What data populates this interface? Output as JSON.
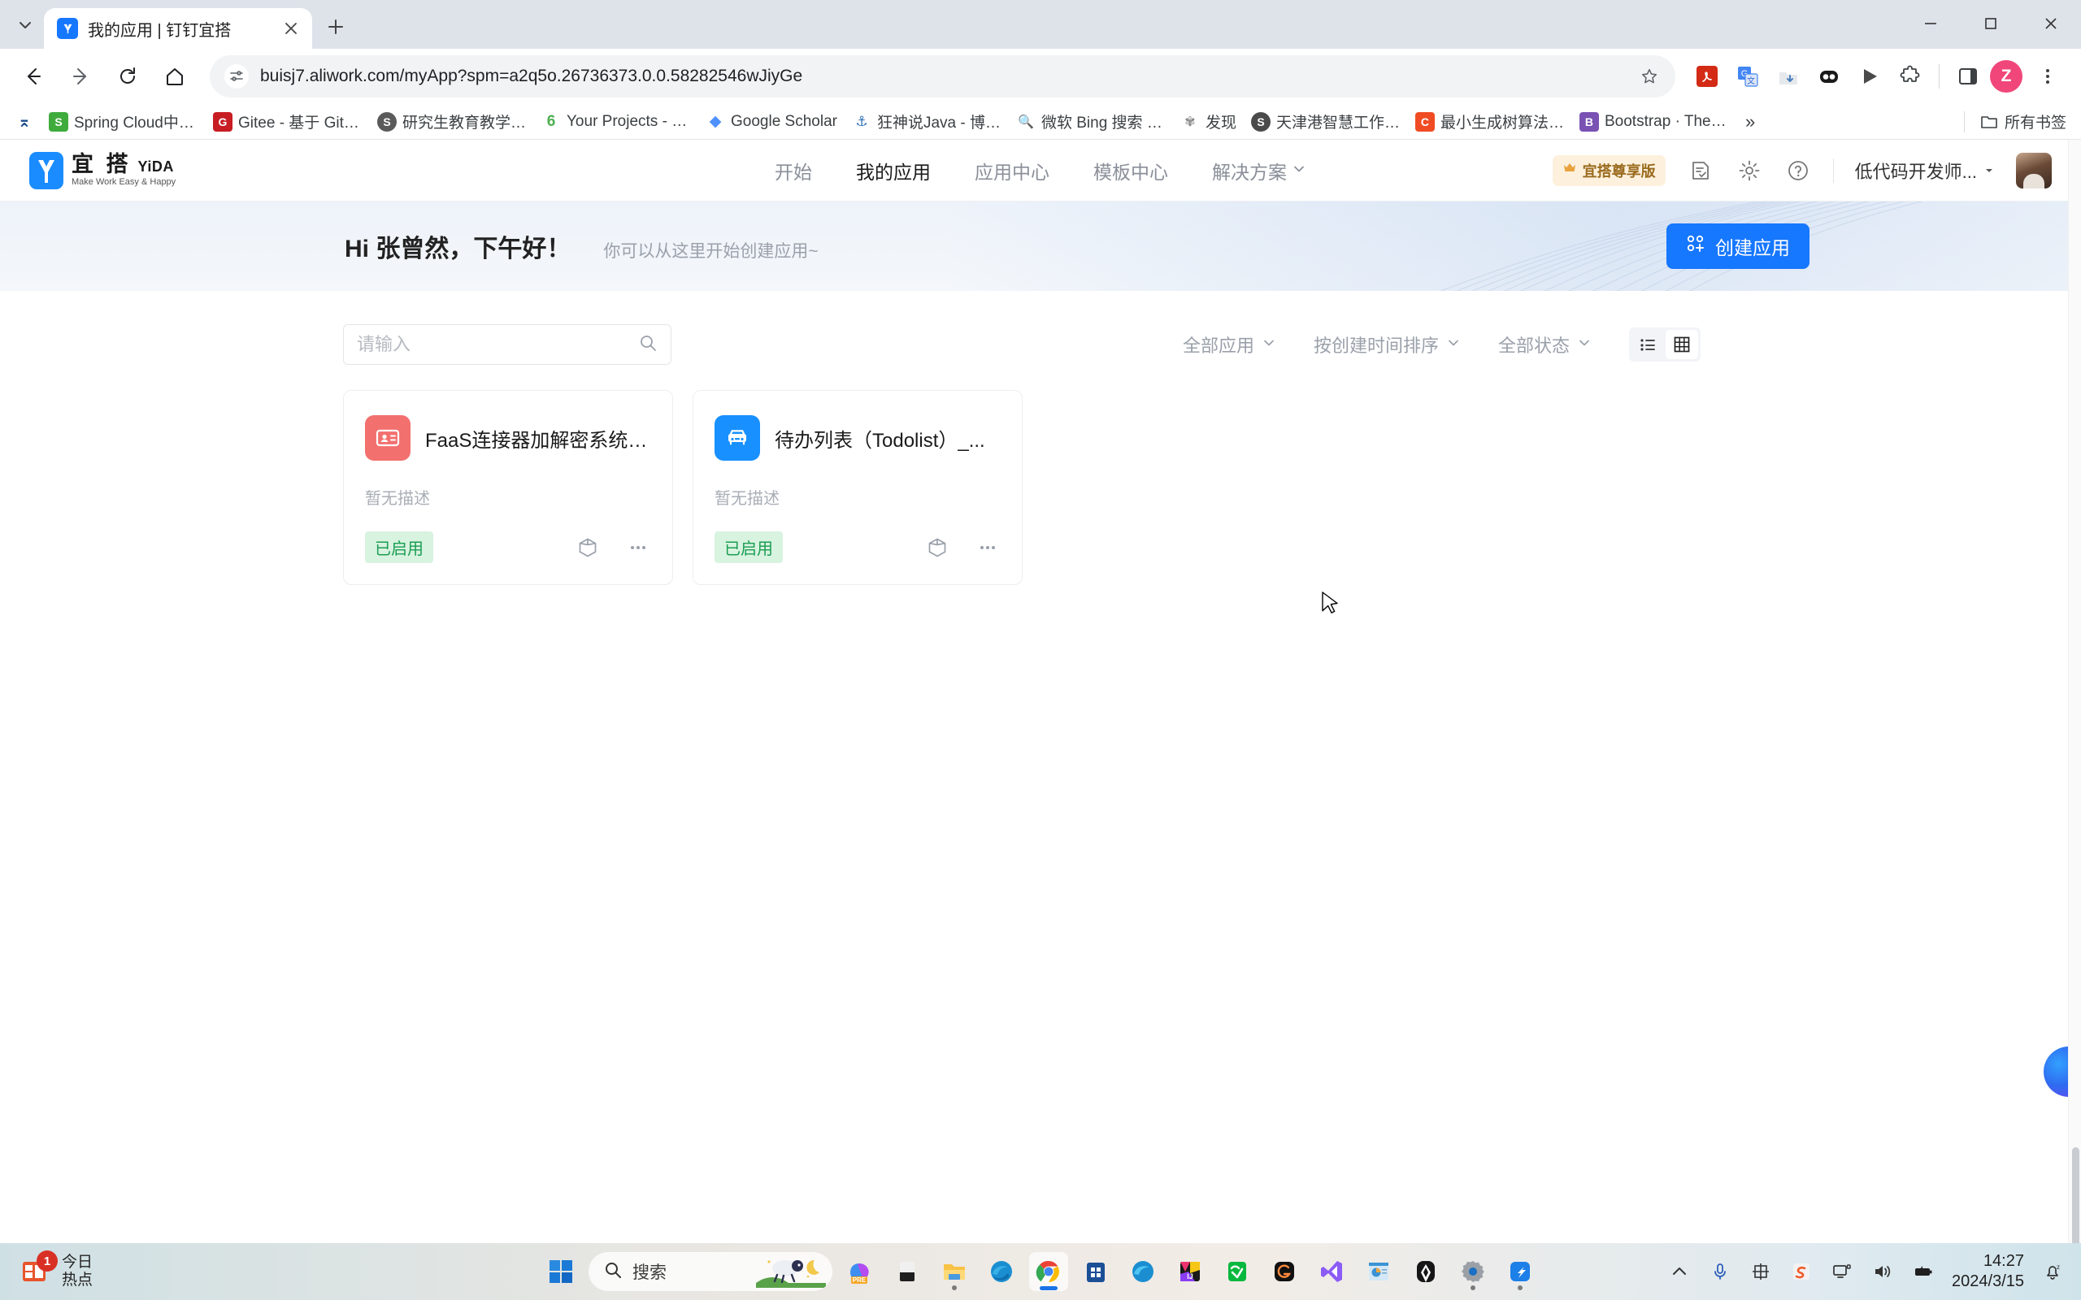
{
  "browser": {
    "tab": {
      "title": "我的应用 | 钉钉宜搭",
      "favicon": "yida-favicon"
    },
    "newtab_label": "+",
    "url": "buisj7.aliwork.com/myApp?spm=a2q5o.26736373.0.0.58282546wJiyGe",
    "profile_initial": "Z",
    "extensions": [
      "adobe-acrobat-icon",
      "google-translate-icon",
      "downloads-icon",
      "extension-dark-icon",
      "play-icon",
      "puzzle-extensions-icon"
    ],
    "nav_icons": [
      "back-icon",
      "forward-icon",
      "reload-icon",
      "home-icon"
    ],
    "bookmarks": [
      {
        "label": "Spring Cloud中国...",
        "color": "#3fab3c",
        "glyph": "S"
      },
      {
        "label": "Gitee - 基于 Git 的...",
        "color": "#c71d23",
        "glyph": "G"
      },
      {
        "label": "研究生教育教学管...",
        "color": "#5a5a5a",
        "glyph": "S"
      },
      {
        "label": "Your Projects - Ov...",
        "color": "#4caf50",
        "glyph": "6"
      },
      {
        "label": "Google Scholar",
        "color": "#4d90fe",
        "glyph": "◆"
      },
      {
        "label": "狂神说Java - 博客园",
        "color": "#2c6fb5",
        "glyph": "⚓"
      },
      {
        "label": "微软 Bing 搜索 - 国...",
        "color": "#1a73e8",
        "glyph": "🔍"
      },
      {
        "label": "发现",
        "color": "#8a8a8a",
        "glyph": "✿"
      },
      {
        "label": "天津港智慧工作平台",
        "color": "#4a4a4a",
        "glyph": "S"
      },
      {
        "label": "最小生成树算法：...",
        "color": "#f04c24",
        "glyph": "C"
      },
      {
        "label": "Bootstrap · The m...",
        "color": "#7952b3",
        "glyph": "B"
      }
    ],
    "bookmarks_overflow": "»",
    "all_bookmarks_label": "所有书签"
  },
  "header": {
    "logo": {
      "cn": "宜 搭",
      "en": "YiDA",
      "tagline": "Make Work Easy & Happy"
    },
    "nav": [
      {
        "label": "开始",
        "active": false
      },
      {
        "label": "我的应用",
        "active": true
      },
      {
        "label": "应用中心",
        "active": false
      },
      {
        "label": "模板中心",
        "active": false
      },
      {
        "label": "解决方案",
        "active": false,
        "caret": true
      }
    ],
    "vip_badge": "宜搭尊享版",
    "icons": [
      "task-list-icon",
      "gear-icon",
      "help-icon"
    ],
    "user": "低代码开发师...",
    "avatar": "user-avatar"
  },
  "banner": {
    "greeting": "Hi 张曾然，下午好！",
    "subtitle": "你可以从这里开始创建应用~",
    "create_button": "创建应用"
  },
  "filters": {
    "search_placeholder": "请输入",
    "search_value": "",
    "dropdowns": [
      "全部应用",
      "按创建时间排序",
      "全部状态"
    ],
    "view_list": "list-view-icon",
    "view_grid": "grid-view-icon",
    "active_view": "grid"
  },
  "apps": [
    {
      "title": "FaaS连接器加解密系统_...",
      "description": "暂无描述",
      "status": "已启用",
      "icon": "id-card-icon",
      "icon_color": "#f2706e"
    },
    {
      "title": "待办列表（Todolist）_...",
      "description": "暂无描述",
      "status": "已启用",
      "icon": "taxi-icon",
      "icon_color": "#1890ff"
    }
  ],
  "taskbar": {
    "widget": {
      "title": "今日",
      "subtitle": "热点",
      "badge": "1"
    },
    "search_placeholder": "搜索",
    "apps": [
      "copilot-pre-icon",
      "widgets-icon",
      "file-explorer-icon",
      "edge-icon",
      "chrome-icon",
      "microsoft-store-icon",
      "edge-dev-icon",
      "intellij-idea-icon",
      "wechat-icon",
      "gitmind-icon",
      "visual-studio-icon",
      "powerpoint-icon",
      "feishu-icon",
      "settings-gear-icon",
      "dingtalk-icon"
    ],
    "tray": [
      "show-hidden-icons-icon",
      "microphone-icon",
      "ime-chinese-icon",
      "sogou-input-icon",
      "display-icon",
      "volume-icon",
      "battery-icon"
    ],
    "time": "14:27",
    "date": "2024/3/15",
    "notification": "notification-bell-icon"
  }
}
